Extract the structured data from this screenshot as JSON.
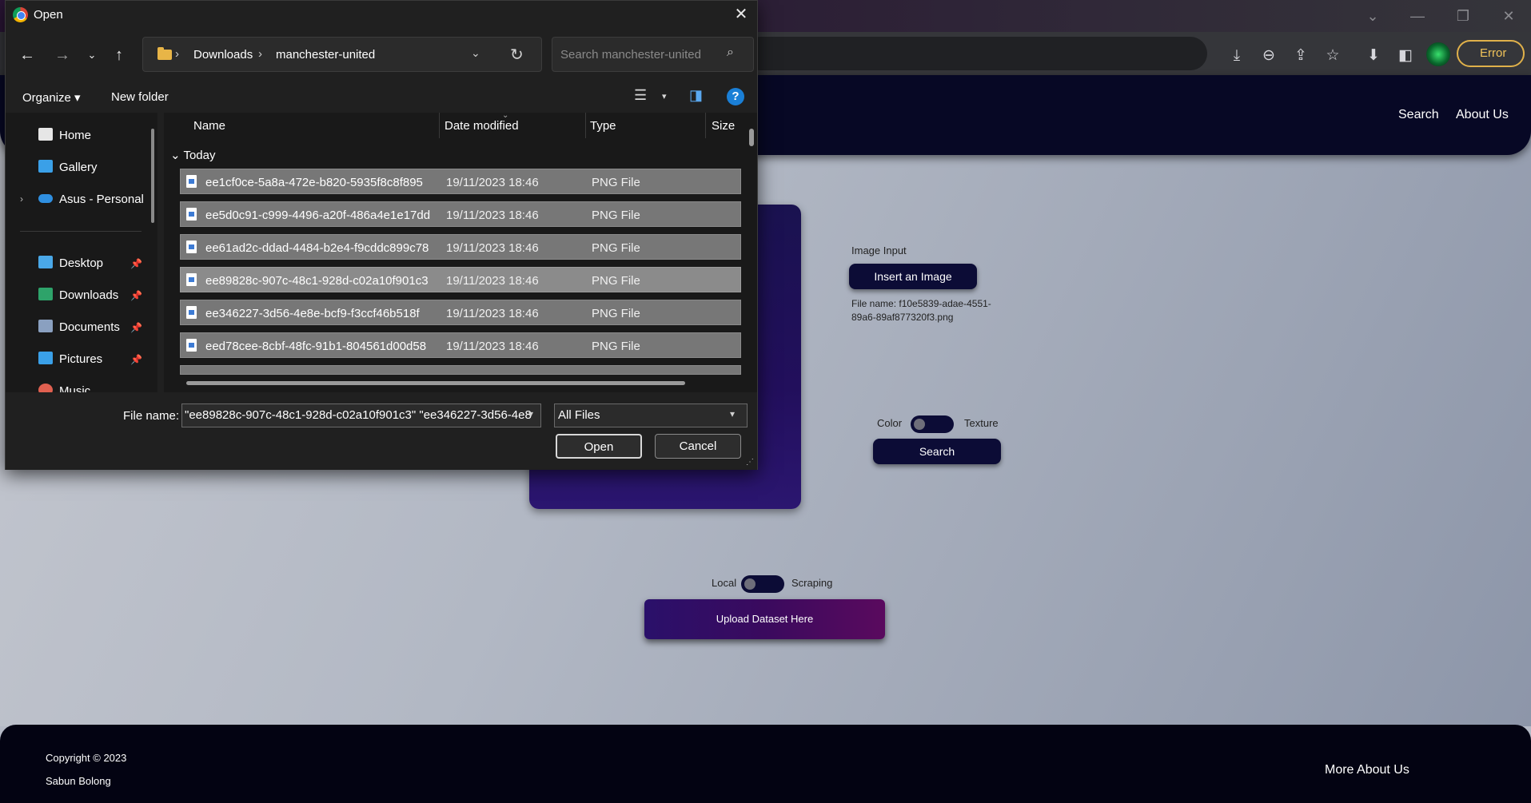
{
  "browser": {
    "window_controls": [
      "⌄",
      "—",
      "❐",
      "✕"
    ],
    "toolbar_icons": [
      "install-icon",
      "zoom-out-icon",
      "share-icon",
      "star-icon",
      "download-icon",
      "sidebar-icon"
    ],
    "error_label": "Error"
  },
  "page": {
    "nav": {
      "search": "Search",
      "about": "About Us"
    },
    "image_input_label": "Image Input",
    "insert_image": "Insert an Image",
    "file_name_line1": "File name: f10e5839-adae-4551-",
    "file_name_line2": "89a6-89af877320f3.png",
    "toggle_left": "Color",
    "toggle_right": "Texture",
    "search_button": "Search",
    "dataset_left": "Local",
    "dataset_right": "Scraping",
    "upload_button": "Upload Dataset Here",
    "footer_copyright": "Copyright © 2023",
    "footer_team": "Sabun Bolong",
    "footer_more": "More About Us"
  },
  "dialog": {
    "title": "Open",
    "close": "✕",
    "path": [
      "Downloads",
      "manchester-united"
    ],
    "search_placeholder": "Search manchester-united",
    "organize": "Organize ▾",
    "new_folder": "New folder",
    "help": "?",
    "nav_items": [
      {
        "label": "Home",
        "icon": "home-icon",
        "color": "#e6e6e6"
      },
      {
        "label": "Gallery",
        "icon": "gallery-icon",
        "color": "#3aa0e8"
      },
      {
        "label": "Asus - Personal",
        "icon": "onedrive-icon",
        "color": "#2f8fe0"
      },
      {
        "label": "Desktop",
        "icon": "desktop-icon",
        "color": "#4aa8e8"
      },
      {
        "label": "Downloads",
        "icon": "downloads-icon",
        "color": "#2ea36a"
      },
      {
        "label": "Documents",
        "icon": "documents-icon",
        "color": "#8aa0c0"
      },
      {
        "label": "Pictures",
        "icon": "pictures-icon",
        "color": "#3aa0e8"
      },
      {
        "label": "Music",
        "icon": "music-icon",
        "color": "#e06050"
      }
    ],
    "columns": {
      "name": "Name",
      "date": "Date modified",
      "type": "Type",
      "size": "Size"
    },
    "group": "Today",
    "files": [
      {
        "name": "ee1cf0ce-5a8a-472e-b820-5935f8c8f895",
        "date": "19/11/2023 18:46",
        "type": "PNG File",
        "selected": false
      },
      {
        "name": "ee5d0c91-c999-4496-a20f-486a4e1e17dd",
        "date": "19/11/2023 18:46",
        "type": "PNG File",
        "selected": false
      },
      {
        "name": "ee61ad2c-ddad-4484-b2e4-f9cddc899c78",
        "date": "19/11/2023 18:46",
        "type": "PNG File",
        "selected": false
      },
      {
        "name": "ee89828c-907c-48c1-928d-c02a10f901c3",
        "date": "19/11/2023 18:46",
        "type": "PNG File",
        "selected": true
      },
      {
        "name": "ee346227-3d56-4e8e-bcf9-f3ccf46b518f",
        "date": "19/11/2023 18:46",
        "type": "PNG File",
        "selected": false
      },
      {
        "name": "eed78cee-8cbf-48fc-91b1-804561d00d58",
        "date": "19/11/2023 18:46",
        "type": "PNG File",
        "selected": false
      }
    ],
    "file_name_label": "File name:",
    "file_name_value": "\"ee89828c-907c-48c1-928d-c02a10f901c3\" \"ee346227-3d56-4e8",
    "filter": "All Files",
    "open": "Open",
    "cancel": "Cancel"
  }
}
